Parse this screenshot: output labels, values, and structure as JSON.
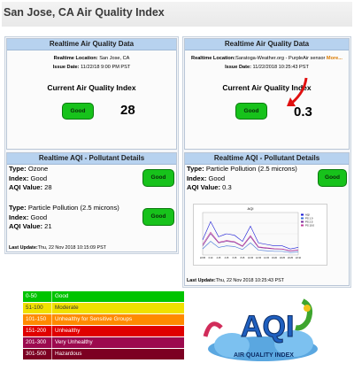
{
  "page_title": "San Jose, CA Air Quality Index",
  "left_panel": {
    "header": "Realtime Air Quality Data",
    "location_label": "Realtime Location:",
    "location_value": "San Jose, CA",
    "issue_label": "Issue Date:",
    "issue_value": "11/22/18 9:00 PM PST",
    "current_label": "Current Air Quality Index",
    "status": "Good",
    "aqi": "28",
    "details_header": "Realtime AQI - Pollutant Details",
    "pollutants": [
      {
        "type_label": "Type:",
        "type": "Ozone",
        "index_label": "Index:",
        "index": "Good",
        "value_label": "AQI Value:",
        "value": "28",
        "button": "Good"
      },
      {
        "type_label": "Type:",
        "type": "Particle Pollution (2.5 microns)",
        "index_label": "Index:",
        "index": "Good",
        "value_label": "AQI Value:",
        "value": "21",
        "button": "Good"
      }
    ],
    "last_update_label": "Last Update:",
    "last_update": "Thu, 22 Nov 2018 10:15:09 PST"
  },
  "right_panel": {
    "header": "Realtime Air Quality Data",
    "location_label": "Realtime Location:",
    "location_value": "Saratoga-Weather.org - PurpleAir sensor",
    "location_more": "More...",
    "issue_label": "Issue Date:",
    "issue_value": "11/22/2018 10:25:43 PST",
    "current_label": "Current Air Quality Index",
    "status": "Good",
    "aqi": "0.3",
    "details_header": "Realtime AQI - Pollutant Details",
    "pollutant": {
      "type_label": "Type:",
      "type": "Particle Pollution (2.5 microns)",
      "index_label": "Index:",
      "index": "Good",
      "value_label": "AQI Value:",
      "value": "0.3",
      "button": "Good"
    },
    "last_update_label": "Last Update:",
    "last_update": "Thu, 22 Nov 2018 10:25:43 PST"
  },
  "chart_data": {
    "type": "line",
    "title": "AQI",
    "x": [
      "22:05",
      "0:10",
      "2:15",
      "4:15",
      "6:15",
      "8:15",
      "10:15",
      "12:15",
      "14:15",
      "16:20",
      "18:25",
      "20:25",
      "22:10"
    ],
    "series": [
      {
        "name": "AQI",
        "color": "#1a1ad6",
        "values": [
          50,
          110,
          60,
          70,
          65,
          45,
          95,
          40,
          35,
          30,
          30,
          20,
          25
        ]
      },
      {
        "name": "PS 1.0",
        "color": "#3b6fd8",
        "values": [
          20,
          45,
          25,
          30,
          28,
          18,
          40,
          16,
          14,
          12,
          12,
          8,
          10
        ]
      },
      {
        "name": "PS 2.5",
        "color": "#7a2e9c",
        "values": [
          30,
          70,
          40,
          45,
          42,
          28,
          60,
          25,
          22,
          20,
          19,
          13,
          16
        ]
      },
      {
        "name": "PS 10.0",
        "color": "#c0399b",
        "values": [
          35,
          75,
          42,
          48,
          44,
          30,
          64,
          27,
          24,
          21,
          20,
          14,
          17
        ]
      }
    ],
    "ylim": [
      0,
      140
    ]
  },
  "legend": [
    {
      "range": "0-50",
      "label": "Good",
      "color": "#00c400"
    },
    {
      "range": "51-100",
      "label": "Moderate",
      "color": "#f0e000"
    },
    {
      "range": "101-150",
      "label": "Unhealthy for Sensitive Groups",
      "color": "#ff8a00"
    },
    {
      "range": "151-200",
      "label": "Unhealthy",
      "color": "#e00000"
    },
    {
      "range": "201-300",
      "label": "Very Unhealthy",
      "color": "#9c0a4e"
    },
    {
      "range": "301-500",
      "label": "Hazardous",
      "color": "#7c0022"
    }
  ],
  "logo": {
    "big": "AQI",
    "text": "AIR QUALITY INDEX"
  },
  "colors": {
    "good_button": "#17c21b",
    "header_bg": "#b7d2ef",
    "arrow": "#e01010"
  }
}
